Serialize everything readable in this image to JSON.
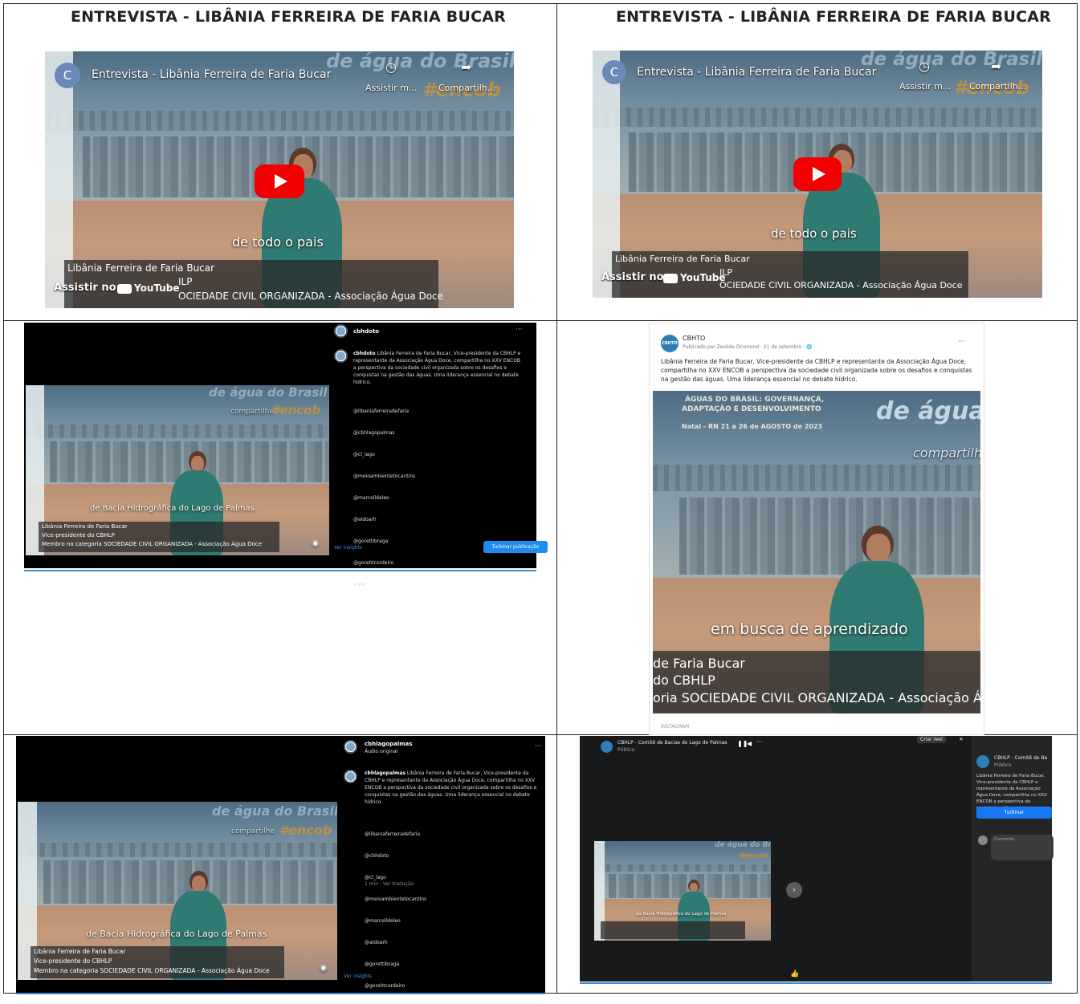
{
  "headings": {
    "left": "ENTREVISTA - LIBÂNIA FERREIRA DE FARIA BUCAR",
    "right": "ENTREVISTA - LIBÂNIA FERREIRA DE FARIA BUCAR"
  },
  "youtube_left": {
    "channel_initial": "C",
    "title": "Entrevista - Libânia Ferreira de Faria Bucar",
    "watch_later": "Assistir m...",
    "share": "Compartilh...",
    "caption": "de todo o pais",
    "watch_on": "Assistir no",
    "yt_logo": "YouTube",
    "name_line": "Libânia Ferreira de Faria Bucar",
    "frag": "ILP",
    "category": "OCIEDADE CIVIL ORGANIZADA - Associação Água Doce",
    "banner_top": "de água do Brasil !",
    "banner_hash": "#encob",
    "banner_share": "compartilhe"
  },
  "youtube_right": {
    "channel_initial": "C",
    "title": "Entrevista - Libânia Ferreira de Faria Bucar",
    "watch_later": "Assistir m...",
    "share": "Compartilh...",
    "caption": "de todo o pais",
    "watch_on": "Assistir no",
    "yt_logo": "YouTube",
    "name_line": "Libânia Ferreira de Faria Bucar",
    "frag": "ILP",
    "category": "OCIEDADE CIVIL ORGANIZADA - Associação Água Doce",
    "banner_top": "de água do Brasil !",
    "banner_hash": "#encob",
    "banner_share": "compartilhe"
  },
  "instagram_1": {
    "account": "cbhdoto",
    "caption_name": "cbhdoto",
    "caption": "Libânia Ferreira de Faria Bucar, Vice-presidente da CBHLP e representante da Associação Água Doce, compartilha no XXV ENCOB a perspectiva da sociedade civil organizada sobre os desafios e conquistas na gestão das águas. Uma liderança essencial no debate hídrico.",
    "tags": [
      "@libaniaferreiradefaria",
      "@cbhlagopalmas",
      "@cl_lago",
      "@meioambientetocantins",
      "@marcelldeleo",
      "@aldoarh",
      "@gorettibraga",
      "@gorehtcordeiro",
      "###"
    ],
    "insights": "Ver insights",
    "boost": "Turbinar publicação",
    "video_caption": "de Bacia Hidrográfica do Lago de Palmas",
    "l3_name": "Libânia Ferreira de Faria Bucar",
    "l3_role": "Vice-presidente do CBHLP",
    "l3_cat": "Membro na categoria SOCIEDADE CIVIL ORGANIZADA - Associação Água Doce",
    "banner_top": "de água do Brasil !",
    "banner_share": "compartilhe",
    "banner_hash": "#encob"
  },
  "facebook_card": {
    "logo_text": "CBHTO",
    "page_name": "CBHTO",
    "meta": "Publicado por Zenilde Drumond · 21 de setembro · ",
    "text": "Libânia Ferreira de Faria Bucar, Vice-presidente da CBHLP e representante da Associação Água Doce, compartilha no XXV ENCOB a perspectiva da sociedade civil organizada sobre os desafios e conquistas na gestão das águas. Uma liderança essencial no debate hídrico.",
    "banner_line1": "ÁGUAS DO BRASIL: GOVERNANÇA,",
    "banner_line2": "ADAPTAÇÃO E DESENVOLVIMENTO",
    "banner_line3": "Natal - RN   21 a 26 de AGOSTO de 2023",
    "banner_big": "de água d",
    "banner_share": "compartilh",
    "caption": "em busca de aprendizado",
    "l3_name": "de Faria Bucar",
    "l3_role": "do CBHLP",
    "l3_cat": "oria SOCIEDADE CIVIL ORGANIZADA - Associação Água",
    "footer": "INSTAGRAM"
  },
  "instagram_2": {
    "account": "cbhlagopalmas",
    "audio": "Áudio original",
    "caption_name": "cbhlagopalmas",
    "caption": "Libânia Ferreira de Faria Bucar, Vice-presidente da CBHLP e representante da Associação Água Doce, compartilha no XXV ENCOB a perspectiva da sociedade civil organizada sobre os desafios e conquistas na gestão das águas. Uma liderança essencial no debate hídrico.",
    "tags": [
      "@libaniaferreiradefaria",
      "@cbhdoto",
      "@cl_lago",
      "@meioambientetocantins",
      "@marcelldeleo",
      "@aldoarh",
      "@gorettibraga",
      "@gorehtcordeiro"
    ],
    "time": "1 min · Ver tradução",
    "insights": "Ver insights",
    "video_caption": "de Bacia Hidrográfica do Lago de Palmas",
    "l3_name": "Libânia Ferreira de Faria Bucar",
    "l3_role": "Vice-presidente do CBHLP",
    "l3_cat": "Membro na categoria SOCIEDADE CIVIL ORGANIZADA - Associação Água Doce",
    "banner_top": "de água do Brasil !",
    "banner_share": "compartilhe",
    "banner_hash": "#encob"
  },
  "facebook_dark": {
    "page": "CBHLP - Comitê de Bacias do Lago de Palmas",
    "privacy": "Público",
    "create": "Criar reel",
    "side_name": "CBHLP - Comitê de Ba",
    "side_privacy": "Público",
    "side_text": "Libânia Ferreira de Faria Bucar, Vice-presidente da CBHLP e representante da Associação Água Doce, compartilha no XXV ENCOB a perspectiva da sociedade... Ver mais",
    "boost": "Turbinar",
    "comment": "Comente...",
    "video_caption": "da Bacia Hidrográfica do Lago de Palmas",
    "banner_top": "de água do Brasil",
    "banner_hash": "#encob"
  },
  "colors": {
    "yt_red": "#f00000",
    "ig_blue": "#1d8cf0",
    "fb_blue": "#1877f2",
    "border": "#222222",
    "teal_shirt": "#2f7a72"
  }
}
